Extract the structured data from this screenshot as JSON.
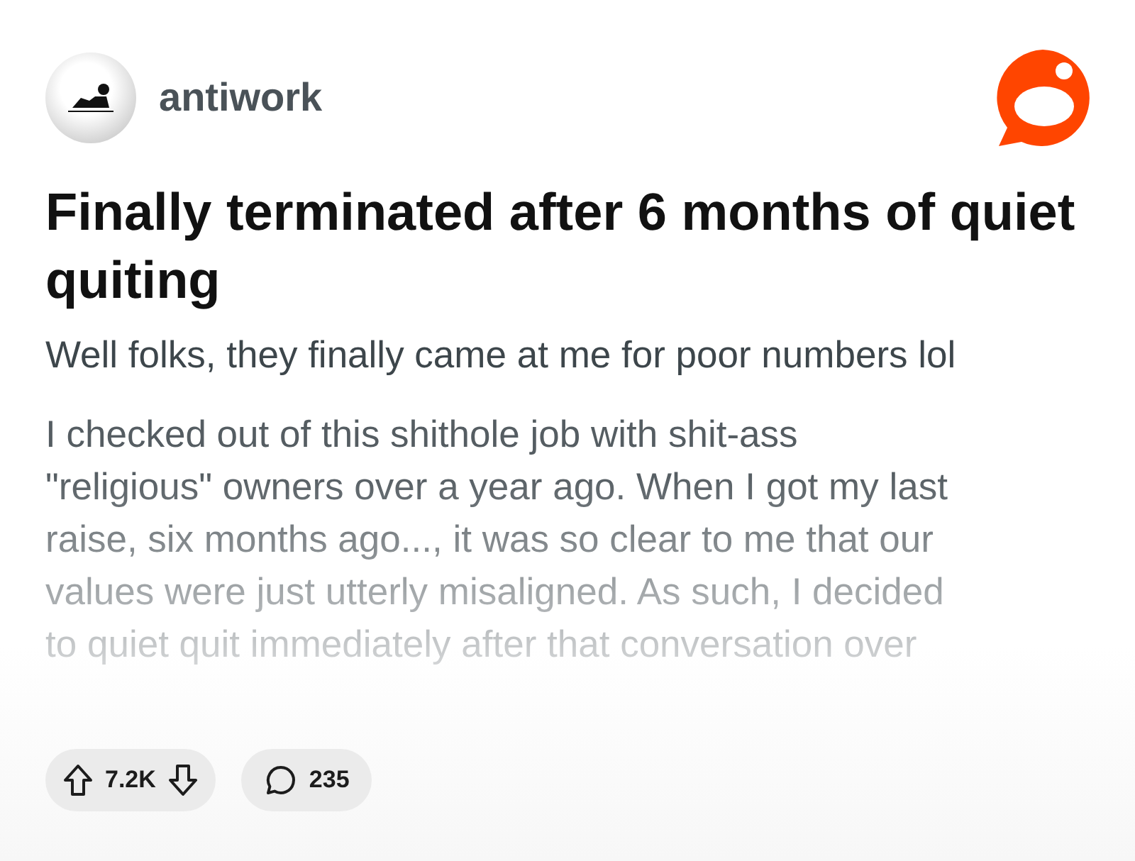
{
  "community": {
    "name": "antiwork"
  },
  "post": {
    "title": "Finally terminated after 6 months of quiet quiting",
    "subtitle": "Well folks, they finally came at me for poor numbers lol",
    "body": "I checked out of this shithole job with shit-ass\n\"religious\" owners over a year ago. When I got my last\nraise, six months ago..., it was so clear to me that our\nvalues were just utterly misaligned. As such, I decided\nto quiet quit immediately after that conversation over"
  },
  "actions": {
    "votes": "7.2K",
    "comments": "235"
  }
}
